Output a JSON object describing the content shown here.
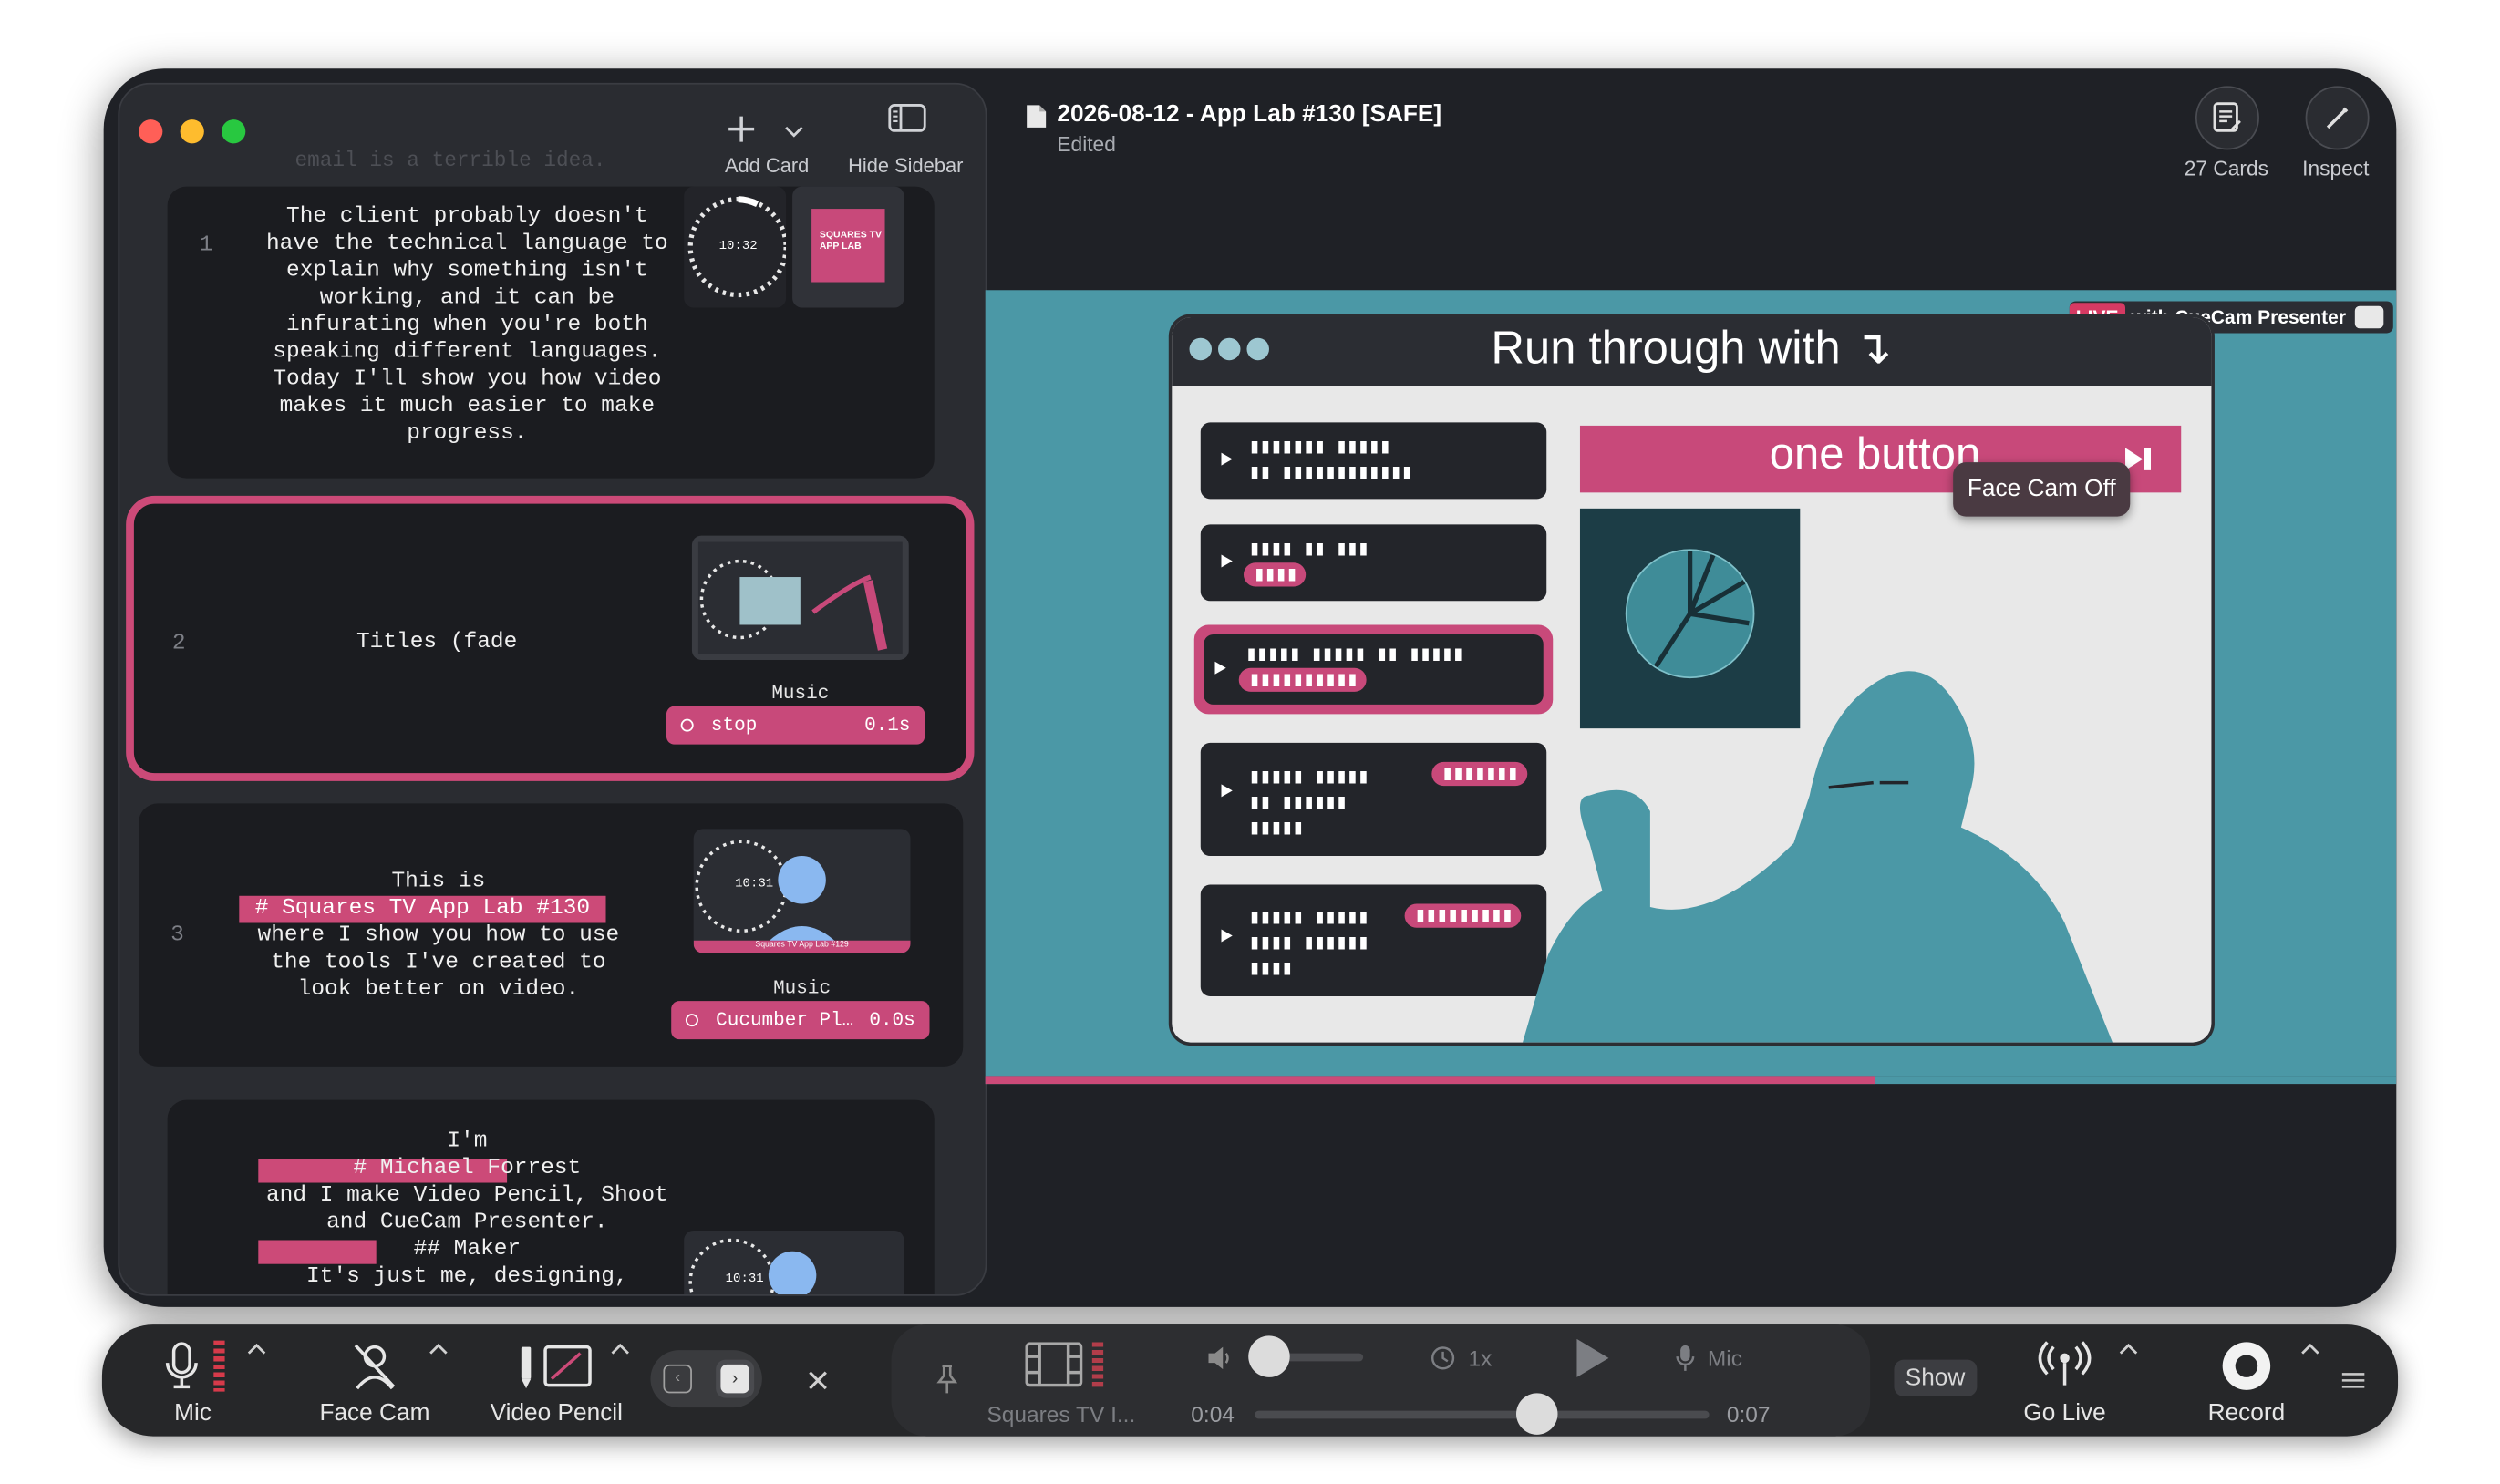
{
  "window": {
    "doc_title": "2026-08-12 - App Lab #130 [SAFE]",
    "doc_status": "Edited"
  },
  "sidebar": {
    "add_card_label": "Add Card",
    "hide_sidebar_label": "Hide Sidebar",
    "ghost_text": "email is a terrible idea.",
    "cards": [
      {
        "number": "1",
        "text": "The client probably doesn't\nhave the technical language to\nexplain why something isn't\nworking, and it can be\ninfurating when you're both\nspeaking different languages.\nToday I'll show you how video\nmakes it much easier to make\nprogress.",
        "thumb_clock": "10:32",
        "thumb_title_card": "SQUARES TV\nAPP LAB"
      },
      {
        "number": "2",
        "text": "Titles (fade",
        "music_label": "Music",
        "music_action": "stop",
        "music_time": "0.1s"
      },
      {
        "number": "3",
        "line1": "This is",
        "highlight": "# Squares TV App Lab #130",
        "rest": "where I show you how to use\nthe tools I've created to\nlook better on video.",
        "thumb_clock": "10:31",
        "thumb_caption": "Squares TV App Lab #129",
        "music_label": "Music",
        "music_action": "Cucumber Pl…",
        "music_time": "0.0s"
      },
      {
        "number": "4",
        "line1": "I'm",
        "highlight": "# Michael Forrest",
        "rest": "and I make Video Pencil, Shoot\nand CueCam Presenter.",
        "heading": "## Maker",
        "tail": "It's just me, designing,",
        "thumb_clock": "10:31"
      }
    ]
  },
  "header_right": {
    "cards_label": "27 Cards",
    "inspect_label": "Inspect"
  },
  "preview": {
    "live_badge": "LIVE",
    "live_text": "with CueCam Presenter",
    "slide_title": "Run through with ↴",
    "one_button": "one button",
    "tooltip": "Face Cam Off",
    "rows": [
      {
        "bars_line1": "▮▮▮▮▮▮▮ ▮▮▮▮▮",
        "bars_line2": "▮▮ ▮▮▮▮▮▮▮▮▮▮▮▮"
      },
      {
        "bars_line1": "▮▮▮▮ ▮▮ ▮▮▮",
        "tag": "▮▮▮▮"
      },
      {
        "bars_line1": "▮▮▮▮▮ ▮▮▮▮▮ ▮▮ ▮▮▮▮▮",
        "tag": "▮▮▮▮▮▮▮▮▮▮"
      },
      {
        "bars_line1": "▮▮▮▮▮ ▮▮▮▮▮",
        "bars_line2": "▮▮ ▮▮▮▮▮▮",
        "bars_line3": "▮▮▮▮▮",
        "tag": "▮▮▮▮▮▮▮"
      },
      {
        "bars_line1": "▮▮▮▮▮ ▮▮▮▮▮",
        "bars_line2": "▮▮▮▮ ▮▮▮▮▮▮",
        "bars_line3": "▮▮▮▮",
        "tag": "▮▮▮▮▮▮▮▮▮"
      }
    ],
    "progress": 0.63,
    "accent": "#cc4a78",
    "teal": "#4b98a6"
  },
  "toolbar": {
    "mic_label": "Mic",
    "face_cam_label": "Face Cam",
    "video_pencil_label": "Video Pencil",
    "media_label": "Squares TV I...",
    "speed_label": "1x",
    "mic_dim_label": "Mic",
    "time_start": "0:04",
    "time_end": "0:07",
    "scrub_progress": 0.62,
    "volume_level": 0.15,
    "show_label": "Show",
    "go_live_label": "Go Live",
    "record_label": "Record"
  }
}
